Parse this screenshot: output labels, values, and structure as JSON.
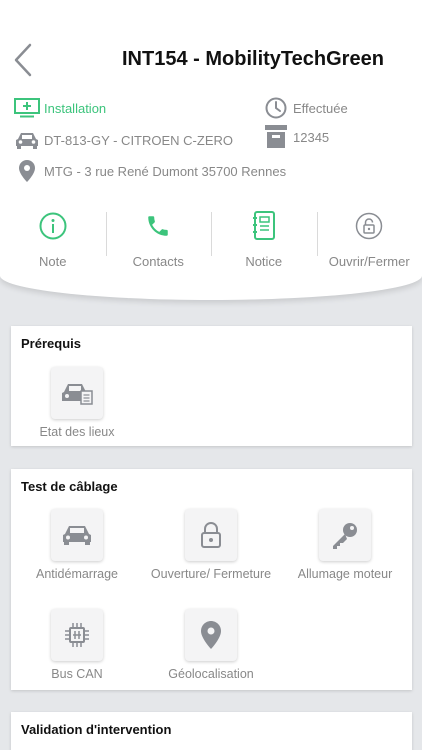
{
  "header": {
    "title": "INT154 - MobilityTechGreen",
    "type_label": "Installation",
    "status_label": "Effectuée",
    "vehicle": "DT-813-GY - CITROEN C-ZERO",
    "box_number": "12345",
    "address": "MTG - 3 rue René Dumont 35700 Rennes"
  },
  "actions": [
    {
      "label": "Note",
      "icon": "info-icon"
    },
    {
      "label": "Contacts",
      "icon": "phone-icon"
    },
    {
      "label": "Notice",
      "icon": "notebook-icon"
    },
    {
      "label": "Ouvrir/Fermer",
      "icon": "lock-icon"
    }
  ],
  "sections": {
    "prerequis": {
      "title": "Prérequis",
      "items": [
        {
          "label": "Etat des lieux",
          "icon": "car-report-icon"
        }
      ]
    },
    "cablage": {
      "title": "Test de câblage",
      "items": [
        {
          "label": "Antidémarrage",
          "icon": "car-icon"
        },
        {
          "label": "Ouverture/ Fermeture",
          "icon": "lock-icon"
        },
        {
          "label": "Allumage moteur",
          "icon": "key-icon"
        },
        {
          "label": "Bus CAN",
          "icon": "chip-icon"
        },
        {
          "label": "Géolocalisation",
          "icon": "location-pin-icon"
        }
      ]
    },
    "validation": {
      "title": "Validation d'intervention"
    }
  },
  "colors": {
    "accent_green": "#3cc47c",
    "icon_grey": "#8a8d93",
    "background": "#e5e7ea"
  }
}
